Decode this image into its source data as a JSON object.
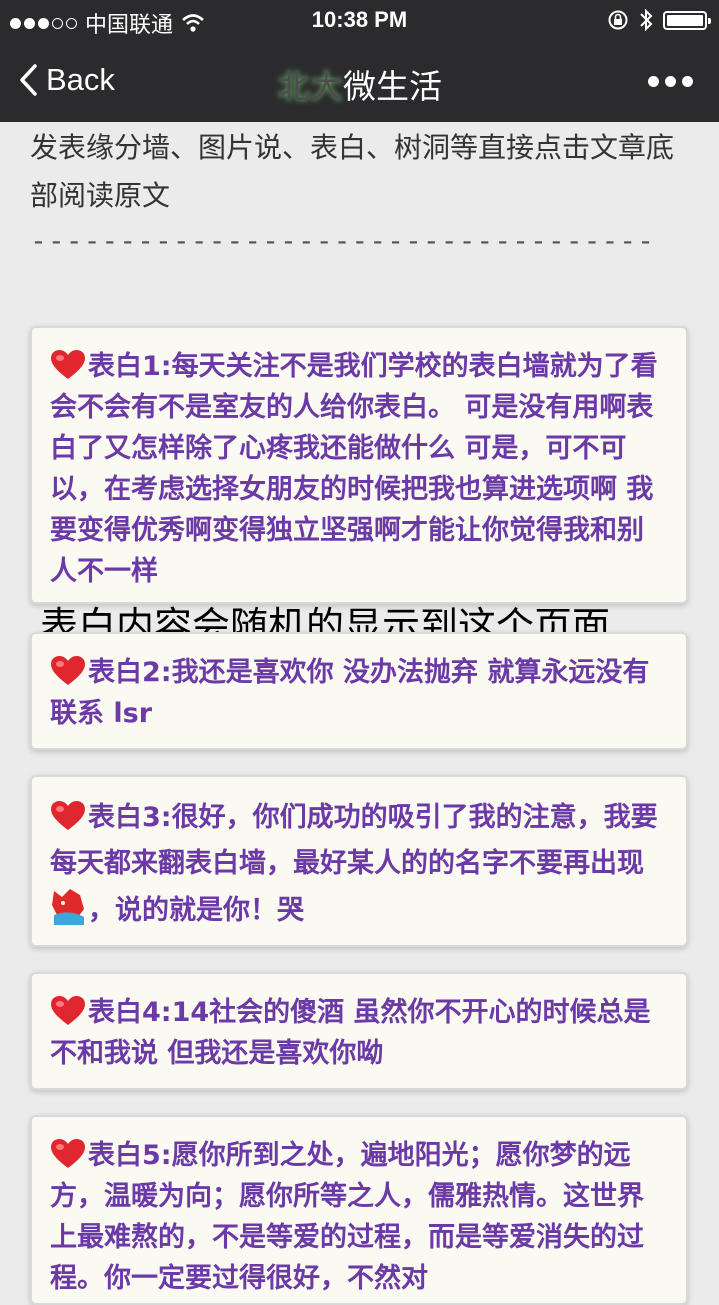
{
  "status_bar": {
    "carrier": "中国联通",
    "time": "10:38 PM"
  },
  "nav": {
    "back_label": "Back",
    "title_obscured": "北大",
    "title": "微生活"
  },
  "intro": {
    "text": "发表缘分墙、图片说、表白、树洞等直接点击文章底部阅读原文",
    "divider": "-----------------------------------"
  },
  "overlay_text": "表白内容会随机的显示到这个页面",
  "cards": [
    {
      "text": "表白1:每天关注不是我们学校的表白墙就为了看会不会有不是室友的人给你表白。 可是没有用啊表白了又怎样除了心疼我还能做什么 可是，可不可以，在考虑选择女朋友的时候把我也算进选项啊 我要变得优秀啊变得独立坚强啊才能让你觉得我和别人不一样"
    },
    {
      "text": "表白2:我还是喜欢你 没办法抛弃 就算永远没有联系 lsr"
    },
    {
      "text_before": "表白3:很好，你们成功的吸引了我的注意，我要每天都来翻表白墙，最好某人的的名字不要再出现",
      "text_after": "，说的就是你！哭"
    },
    {
      "text": "表白4:14社会的傻酒 虽然你不开心的时候总是不和我说 但我还是喜欢你呦"
    },
    {
      "text": "表白5:愿你所到之处，遍地阳光；愿你梦的远方，温暖为向；愿你所等之人，儒雅热情。这世界上最难熬的，不是等爱的过程，而是等爱消失的过程。你一定要过得很好，不然对"
    }
  ],
  "colors": {
    "card_text": "#6b3aa6",
    "bar_bg": "#2b2b2d"
  }
}
